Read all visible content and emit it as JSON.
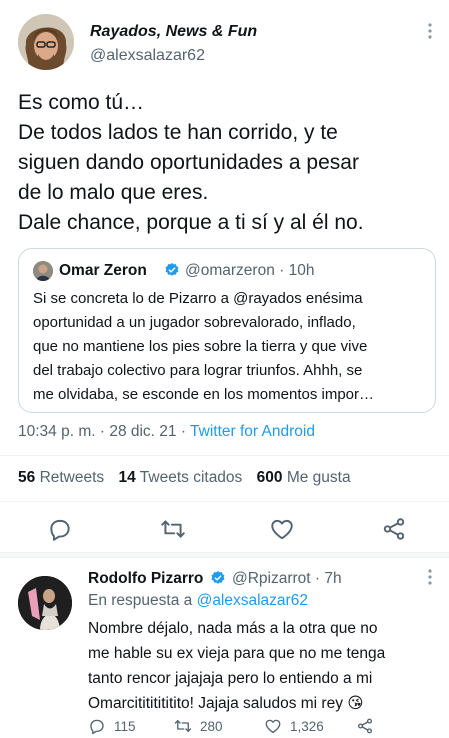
{
  "tweet": {
    "display_name": "Rayados, News & Fun",
    "handle": "@alexsalazar62",
    "text_lines": [
      "Es como tú…",
      "De todos lados te han corrido, y te",
      "siguen dando oportunidades a pesar",
      "de lo malo que eres.",
      "Dale chance,  porque a ti sí y al él no."
    ],
    "timestamp": "10:34 p. m. · 28 dic. 21 · ",
    "source": "Twitter for Android"
  },
  "quote": {
    "name": "Omar Zeron",
    "meta": "@omarzeron · 10h",
    "text_lines": [
      "Si se concreta lo de Pizarro a @rayados enésima",
      "oportunidad a un jugador sobrevalorado, inflado,",
      "que no mantiene los pies sobre la tierra y que vive",
      "del trabajo colectivo para lograr triunfos. Ahhh, se",
      "me olvidaba, se esconde en los momentos impor…"
    ]
  },
  "stats": {
    "retweets_count": "56",
    "retweets_label": "Retweets",
    "quotes_count": "14",
    "quotes_label": "Tweets citados",
    "likes_count": "600",
    "likes_label": "Me gusta"
  },
  "reply": {
    "name": "Rodolfo Pizarro",
    "meta": "@Rpizarrot · 7h",
    "in_reply_prefix": "En respuesta a ",
    "in_reply_mention": "@alexsalazar62",
    "text_lines": [
      "Nombre déjalo, nada más a la otra que no",
      "me hable su ex vieja para que no me tenga",
      "tanto rencor jajajaja pero lo entiendo a mi",
      "Omarcitititititito! Jajaja saludos mi rey 😘"
    ],
    "replies": "115",
    "retweets": "280",
    "likes": "1,326"
  },
  "icons": {
    "reply": "reply-icon",
    "retweet": "retweet-icon",
    "like": "heart-icon",
    "share": "share-icon",
    "verified": "verified-badge-icon",
    "more": "more-options-icon"
  },
  "colors": {
    "accent": "#1d9bf0",
    "secondary_text": "#536471",
    "primary_text": "#0f1419"
  }
}
